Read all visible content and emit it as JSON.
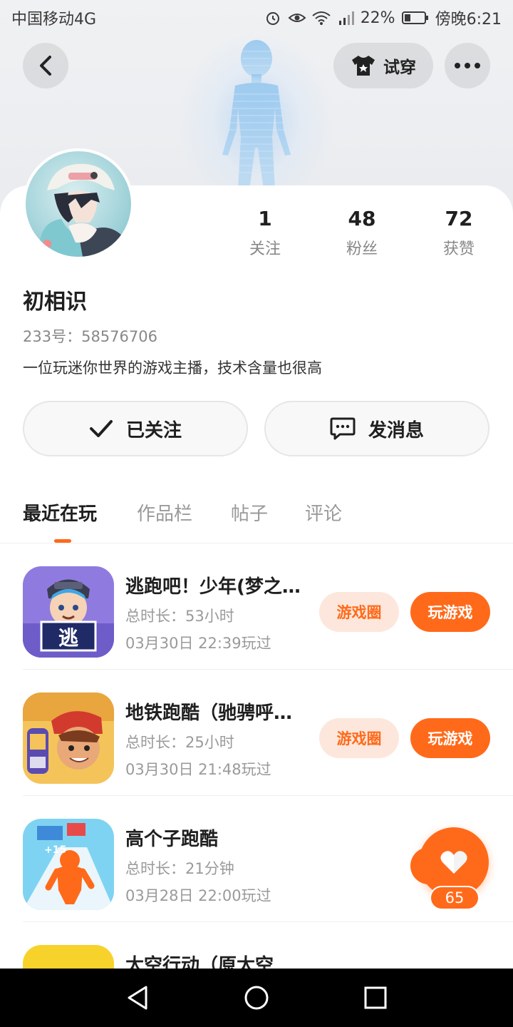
{
  "status_bar": {
    "carrier": "中国移动4G",
    "battery": "22%",
    "time": "傍晚6:21"
  },
  "header": {
    "try_label": "试穿"
  },
  "profile": {
    "stats": [
      {
        "value": "1",
        "label": "关注"
      },
      {
        "value": "48",
        "label": "粉丝"
      },
      {
        "value": "72",
        "label": "获赞"
      }
    ],
    "name": "初相识",
    "id_text": "233号：58576706",
    "bio": "一位玩迷你世界的游戏主播，技术含量也很高",
    "follow_label": "已关注",
    "message_label": "发消息"
  },
  "tabs": [
    "最近在玩",
    "作品栏",
    "帖子",
    "评论"
  ],
  "games": [
    {
      "title": "逃跑吧！少年(梦之…",
      "duration": "总时长：53小时",
      "last_played": "03月30日 22:39玩过",
      "circle_label": "游戏圈",
      "play_label": "玩游戏",
      "icon": "escape-game-icon"
    },
    {
      "title": "地铁跑酷（驰骋呼…",
      "duration": "总时长：25小时",
      "last_played": "03月30日 21:48玩过",
      "circle_label": "游戏圈",
      "play_label": "玩游戏",
      "icon": "subway-surfers-icon"
    },
    {
      "title": "高个子跑酷",
      "duration": "总时长：21分钟",
      "last_played": "03月28日 22:00玩过",
      "icon": "tall-runner-icon"
    },
    {
      "title": "太空行动（原太空",
      "icon": "space-action-icon"
    }
  ],
  "like_button": {
    "count": "65"
  },
  "colors": {
    "accent": "#ff6a1a",
    "accent_light": "#fde7dc"
  }
}
